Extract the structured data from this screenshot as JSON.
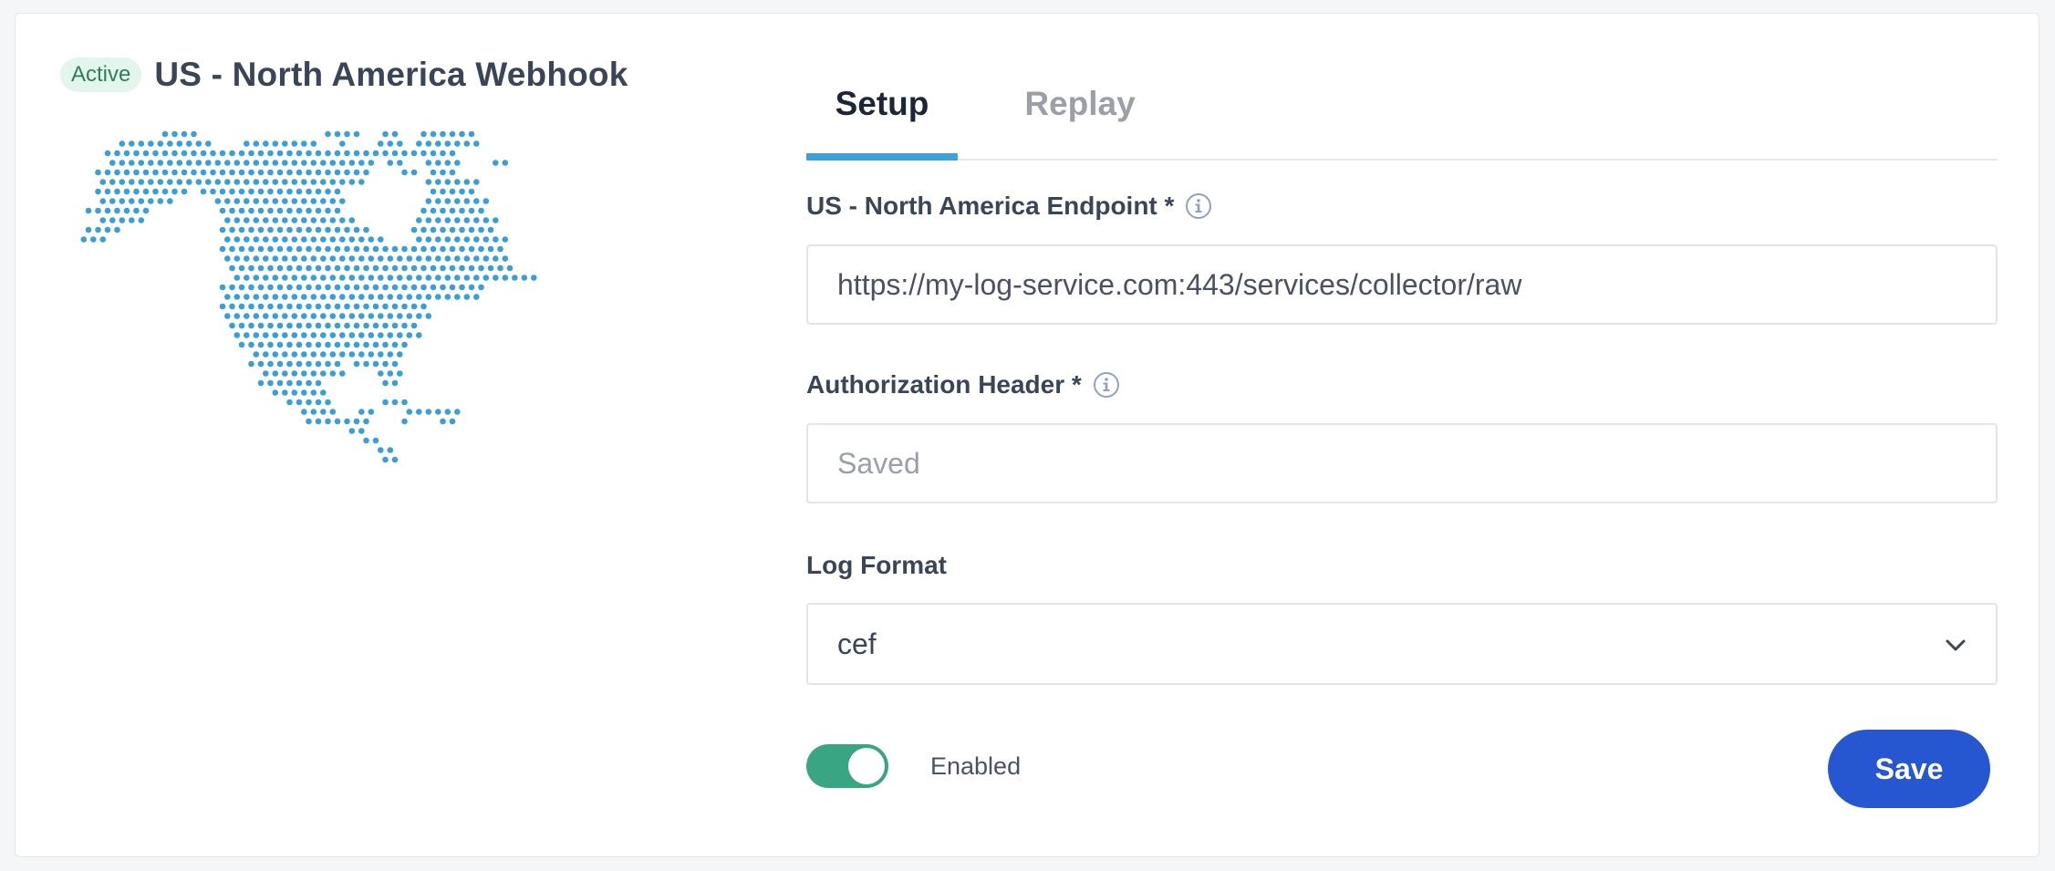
{
  "webhook": {
    "status": "Active",
    "title": "US - North America Webhook",
    "map_icon": "north-america-dot-map"
  },
  "tabs": [
    {
      "label": "Setup",
      "active": true
    },
    {
      "label": "Replay",
      "active": false
    }
  ],
  "form": {
    "endpoint": {
      "label": "US - North America Endpoint *",
      "value": "https://my-log-service.com:443/services/collector/raw",
      "info_icon": "info-icon"
    },
    "auth_header": {
      "label": "Authorization Header *",
      "placeholder": "Saved",
      "info_icon": "info-icon"
    },
    "log_format": {
      "label": "Log Format",
      "value": "cef"
    },
    "enabled": {
      "label": "Enabled",
      "on": true
    },
    "save_label": "Save"
  },
  "colors": {
    "accent": "#3aa2d6",
    "map_dot": "#3a9fd4",
    "toggle_on": "#3aa583",
    "save_button": "#2756d1",
    "badge_bg": "#e3f6ee",
    "badge_text": "#2f7f5a"
  }
}
